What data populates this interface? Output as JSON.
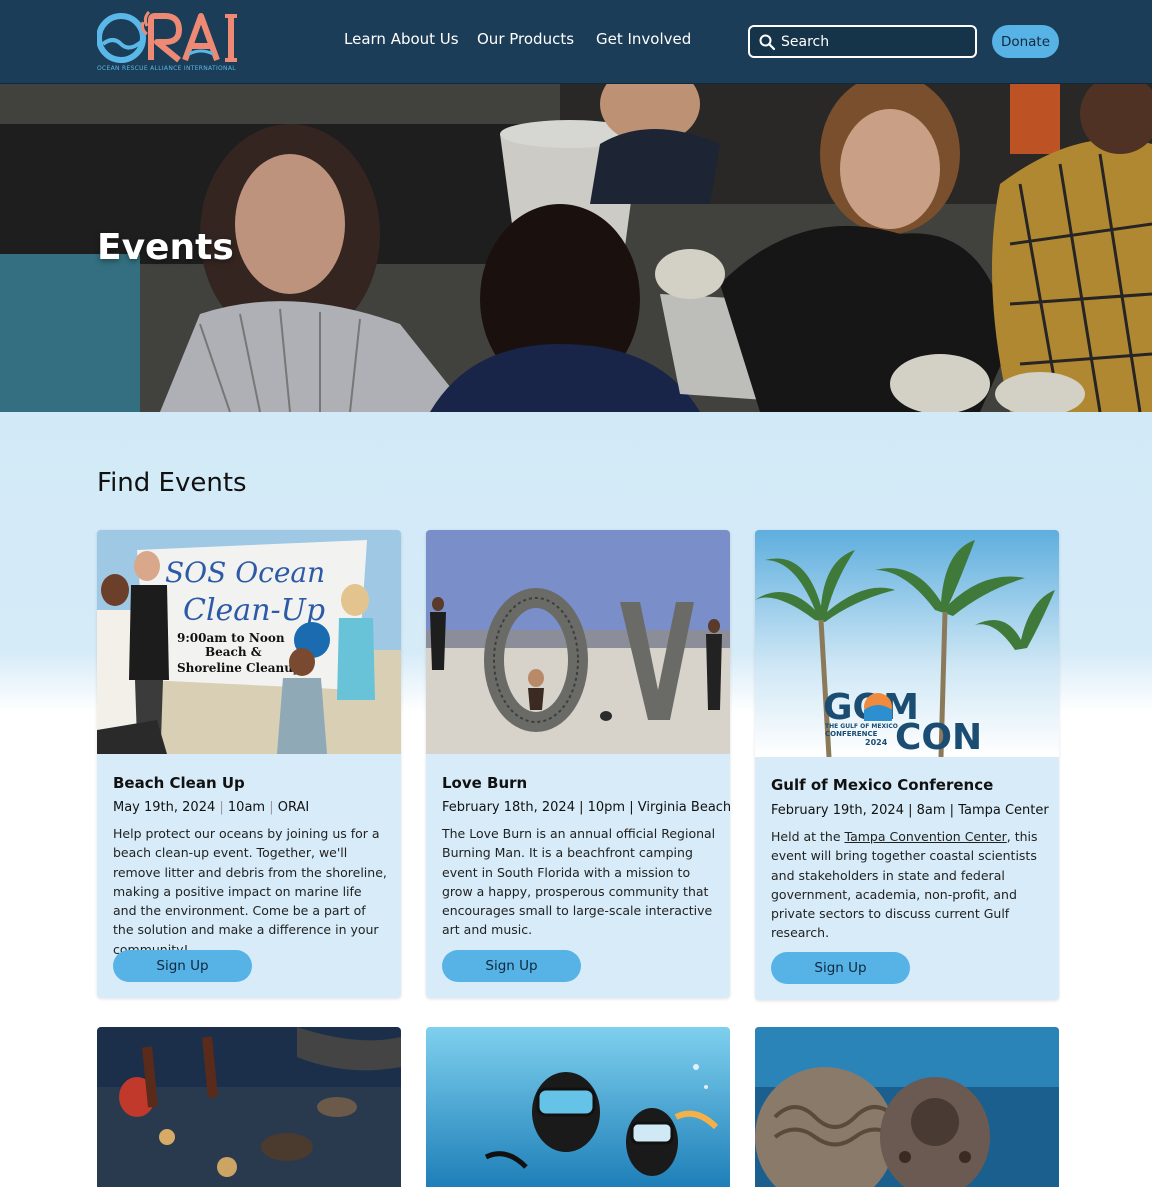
{
  "header": {
    "logo_text": "ORAI",
    "logo_tagline": "OCEAN RESCUE ALLIANCE INTERNATIONAL",
    "nav": [
      "Learn About Us",
      "Our Products",
      "Get Involved"
    ],
    "search_placeholder": "Search",
    "donate_label": "Donate"
  },
  "hero": {
    "title": "Events"
  },
  "events": {
    "section_title": "Find Events",
    "cards": [
      {
        "title": "Beach Clean Up",
        "date": "May 19th, 2024",
        "time": "10am",
        "location": "ORAI",
        "description": "Help protect our oceans by joining us for a beach clean-up event. Together, we'll remove litter and debris from the shoreline, making a positive impact on marine life and the environment. Come be a part of the solution and make a difference in your community!",
        "button": "Sign Up",
        "image_text": [
          "SOS Ocean",
          "Clean-Up",
          "9:00am to Noon",
          "Beach &",
          "Shoreline Cleanup"
        ]
      },
      {
        "title": "Love Burn",
        "date": "February 18th, 2024",
        "time": "10pm",
        "location": "Virginia Beach",
        "description": "The Love Burn is an annual official Regional Burning Man. It is a beachfront camping event in South Florida with a mission to grow a happy, prosperous community that encourages small to large-scale interactive art and music.",
        "button": "Sign Up",
        "image_text": [
          "O",
          "V"
        ]
      },
      {
        "title": "Gulf of Mexico Conference",
        "date": "February 19th, 2024",
        "time": "8am",
        "location": "Tampa Center",
        "description_before": "Held at the ",
        "description_link": "Tampa Convention Center",
        "description_after": ", this event will bring together coastal scientists and stakeholders in state and federal government, academia, non-profit, and private sectors to discuss current Gulf research.",
        "button": "Sign Up",
        "image_text": [
          "GOM",
          "CON",
          "THE GULF OF MEXICO",
          "CONFERENCE",
          "2024"
        ]
      }
    ]
  },
  "colors": {
    "header_bg": "#1b3d57",
    "accent": "#57b2e6",
    "logo_coral": "#ee8a74",
    "logo_blue": "#5ab8e8",
    "card_bg": "#d7ecf8"
  }
}
